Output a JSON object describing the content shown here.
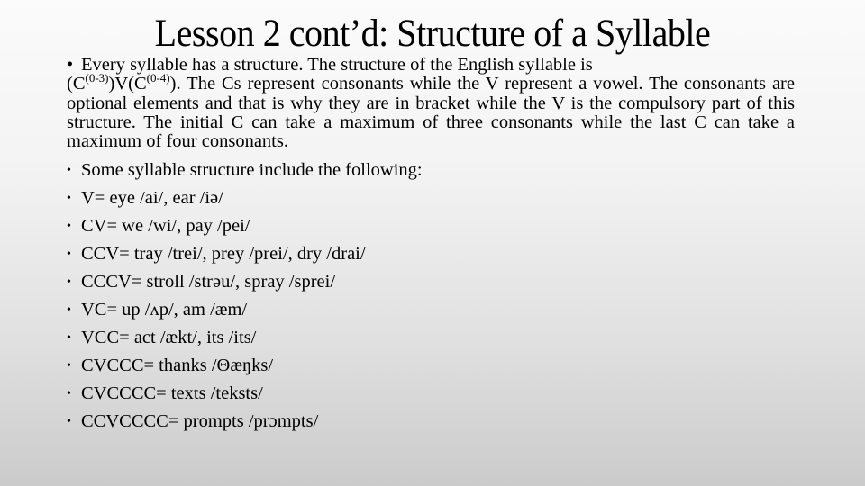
{
  "slide": {
    "title": "Lesson 2 cont’d: Structure of a Syllable",
    "intro": {
      "bullet": "•",
      "first_line": "Every syllable has a structure. The structure of the English syllable is",
      "formula": {
        "open1": "(C",
        "sup1": "(0-3)",
        "mid": ")V(C",
        "sup2": "(0-4)",
        "close": ")."
      },
      "rest": " The Cs represent consonants while the V represent a vowel. The consonants are optional elements and that is why they are in bracket while the V is the compulsory part of this structure. The initial C can take a maximum of three consonants while the last C can take a maximum of four consonants."
    },
    "bullets": [
      {
        "symbol": "•",
        "text": "Some syllable structure include the following:"
      },
      {
        "symbol": "•",
        "text": "V=  eye /ai/, ear /iə/"
      },
      {
        "symbol": "•",
        "text": "CV= we /wi/, pay /pei/"
      },
      {
        "symbol": "•",
        "text": "CCV= tray /trei/, prey /prei/, dry /drai/"
      },
      {
        "symbol": "•",
        "text": "CCCV= stroll /strəu/, spray /sprei/"
      },
      {
        "symbol": "•",
        "text": "VC= up /ʌp/, am /æm/"
      },
      {
        "symbol": "•",
        "text": "VCC= act /ækt/, its /its/"
      },
      {
        "symbol": "•",
        "text": "CVCCC= thanks /Θæŋks/"
      },
      {
        "symbol": "•",
        "text": "CVCCCC= texts /teksts/"
      },
      {
        "symbol": "•",
        "text": "CCVCCCC= prompts /prɔmpts/"
      }
    ]
  }
}
